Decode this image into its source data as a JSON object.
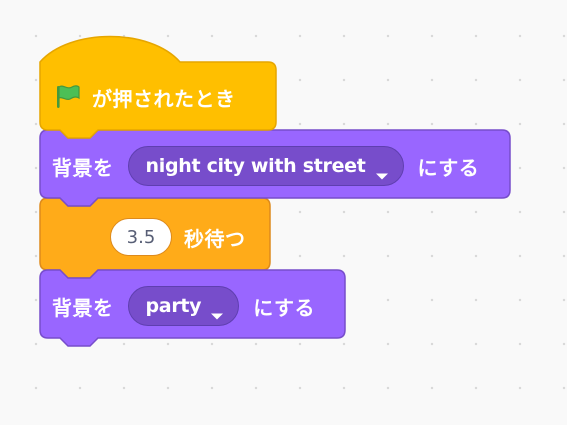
{
  "workspace": {
    "background_color": "#f9f9f9",
    "grid_dot_color": "#d9d9d9"
  },
  "colors": {
    "events": "#ffbf00",
    "events_border": "#e6a600",
    "looks": "#9966ff",
    "looks_border": "#774dcb",
    "control": "#ffab19",
    "control_border": "#dd8a1c",
    "flag_green": "#4cbf56"
  },
  "script": {
    "hat_block": {
      "icon": "green-flag-icon",
      "label": "が押されたとき"
    },
    "switch_backdrop_1": {
      "prefix": "背景を",
      "dropdown_value": "night city with street",
      "dropdown_icon": "caret-down-icon",
      "suffix": "にする"
    },
    "wait_block": {
      "seconds": "3.5",
      "label": "秒待つ"
    },
    "switch_backdrop_2": {
      "prefix": "背景を",
      "dropdown_value": "party",
      "dropdown_icon": "caret-down-icon",
      "suffix": "にする"
    }
  }
}
